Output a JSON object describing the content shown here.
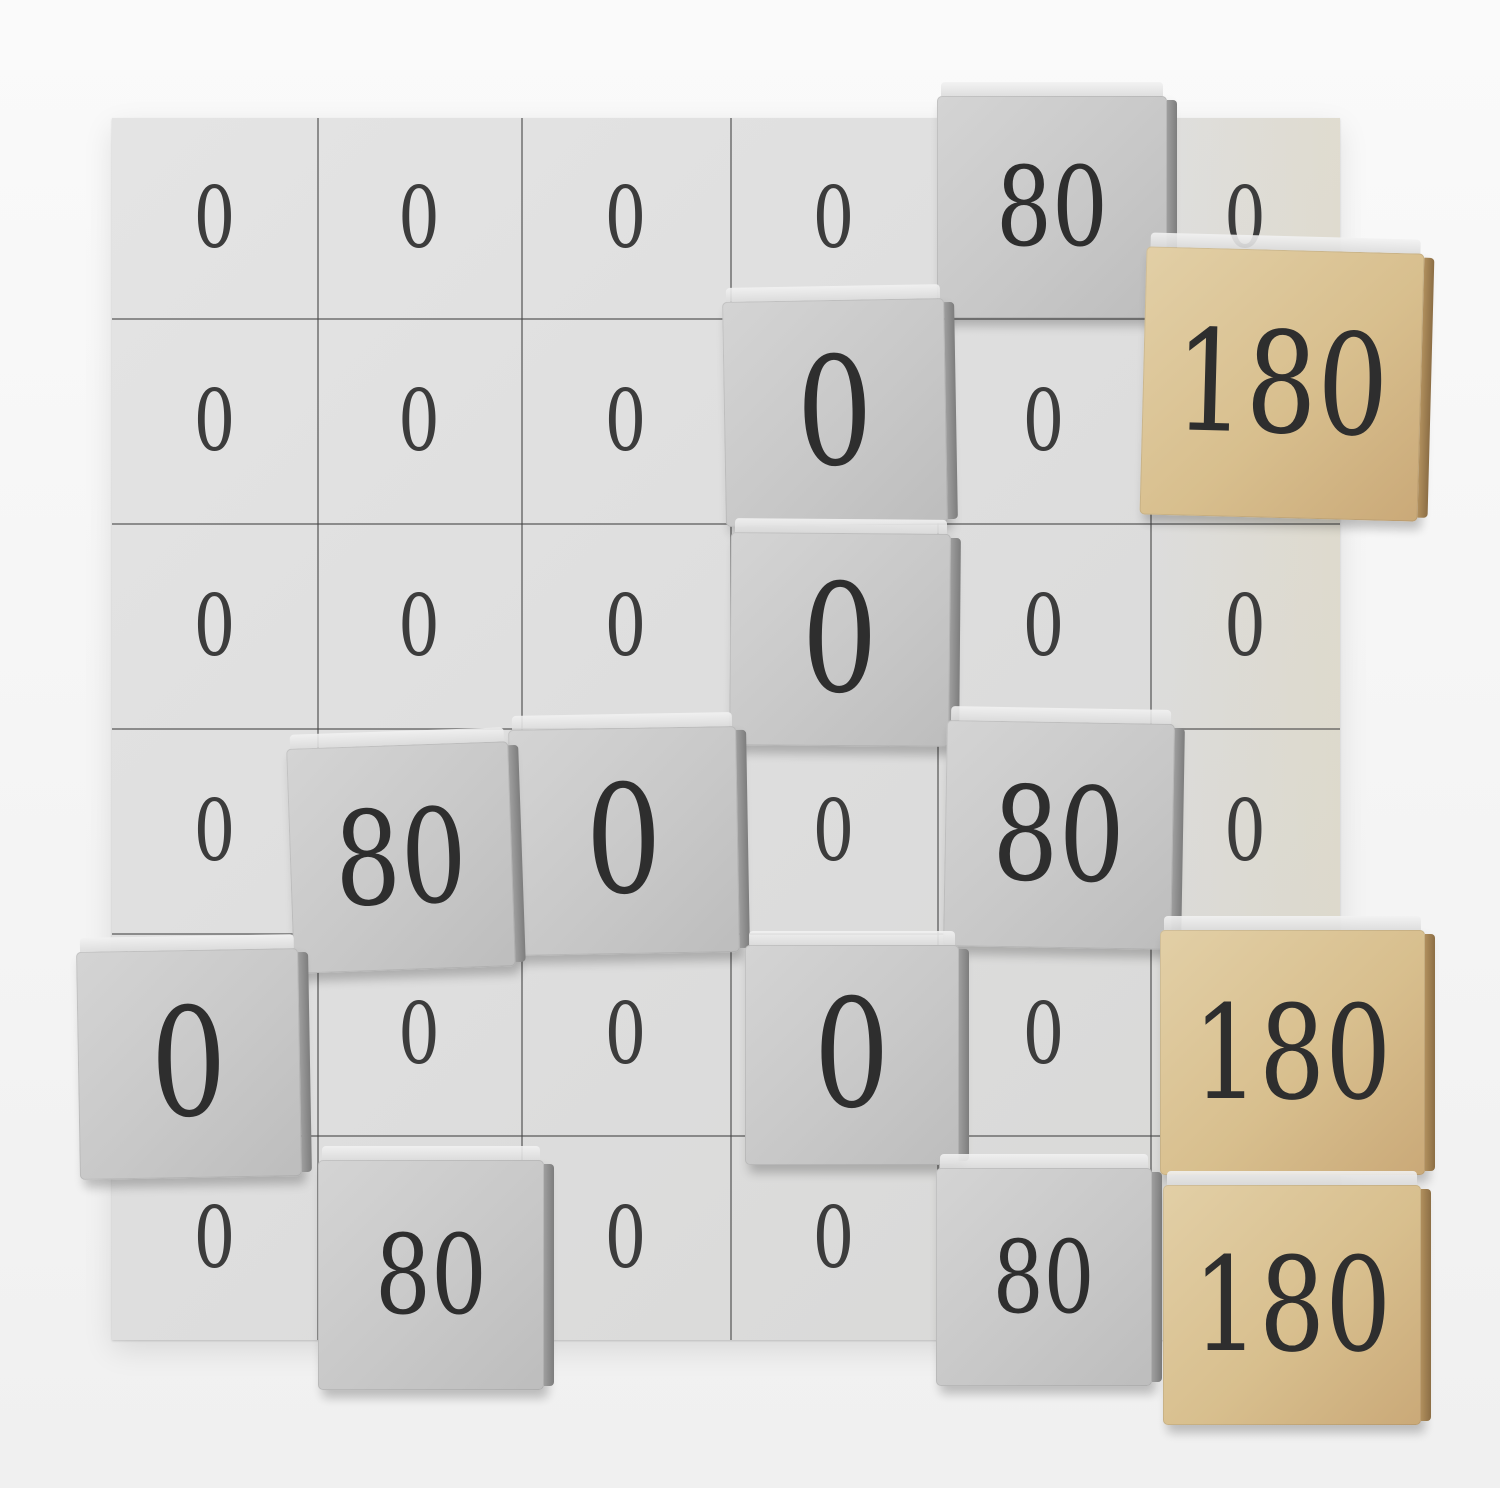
{
  "board": {
    "rows": [
      [
        "0",
        "0",
        "0",
        "0",
        "80",
        "0"
      ],
      [
        "0",
        "0",
        "0",
        "0",
        "0",
        "180"
      ],
      [
        "0",
        "0",
        "0",
        "0",
        "0",
        "0"
      ],
      [
        "0",
        "80",
        "0",
        "0",
        "80",
        "0"
      ],
      [
        "0",
        "0",
        "0",
        "0",
        "0",
        "180"
      ],
      [
        "0",
        "80",
        "0",
        "0",
        "80",
        "180"
      ]
    ]
  },
  "cubes": [
    {
      "value": "80",
      "color": "#c9c9c9"
    },
    {
      "value": "180",
      "color": "#d8bf8e"
    },
    {
      "value": "0",
      "color": "#c9c9c9"
    },
    {
      "value": "0",
      "color": "#c9c9c9"
    },
    {
      "value": "80",
      "color": "#c9c9c9"
    },
    {
      "value": "0",
      "color": "#c9c9c9"
    },
    {
      "value": "80",
      "color": "#c9c9c9"
    },
    {
      "value": "0",
      "color": "#c9c9c9"
    },
    {
      "value": "0",
      "color": "#c9c9c9"
    },
    {
      "value": "180",
      "color": "#d8bf8e"
    },
    {
      "value": "80",
      "color": "#c9c9c9"
    },
    {
      "value": "80",
      "color": "#c9c9c9"
    },
    {
      "value": "180",
      "color": "#d8bf8e"
    }
  ]
}
